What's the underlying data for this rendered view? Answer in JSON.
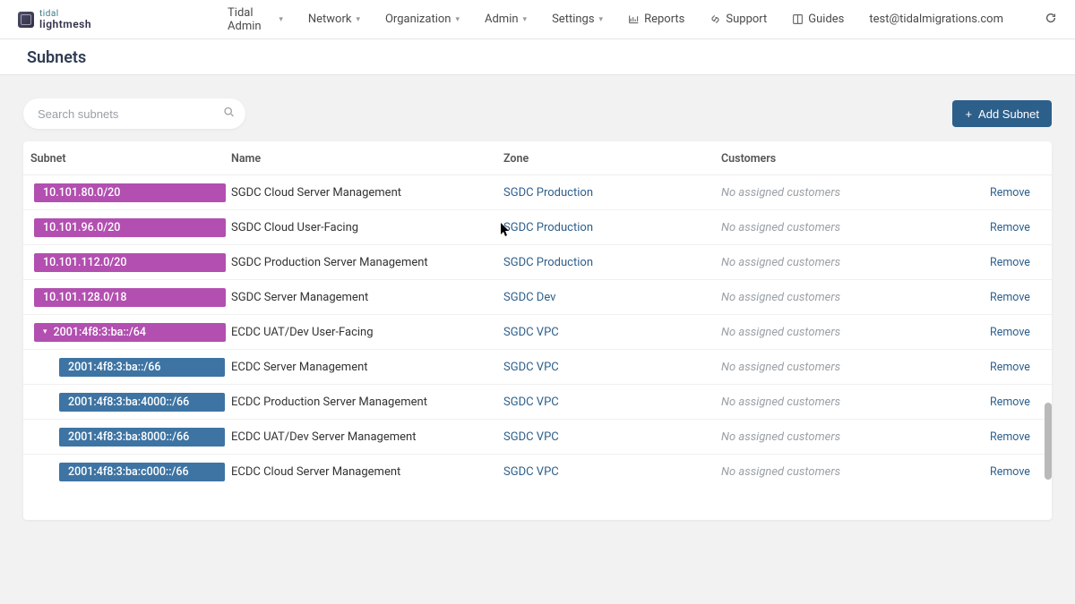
{
  "brand": {
    "line1": "tidal",
    "line2": "lightmesh"
  },
  "nav": {
    "tidal_admin": "Tidal Admin",
    "network": "Network",
    "organization": "Organization",
    "admin": "Admin",
    "settings": "Settings",
    "reports": "Reports",
    "support": "Support",
    "guides": "Guides",
    "user_email": "test@tidalmigrations.com"
  },
  "page_title": "Subnets",
  "search": {
    "placeholder": "Search subnets"
  },
  "add_subnet_label": "Add Subnet",
  "columns": {
    "subnet": "Subnet",
    "name": "Name",
    "zone": "Zone",
    "customers": "Customers"
  },
  "no_customers": "No assigned customers",
  "remove_label": "Remove",
  "rows": [
    {
      "cidr": "10.101.80.0/20",
      "name": "SGDC Cloud Server Management",
      "zone": "SGDC Production",
      "color": "purple",
      "child": false,
      "caret": false
    },
    {
      "cidr": "10.101.96.0/20",
      "name": "SGDC Cloud User-Facing",
      "zone": "SGDC Production",
      "color": "purple",
      "child": false,
      "caret": false
    },
    {
      "cidr": "10.101.112.0/20",
      "name": "SGDC Production Server Management",
      "zone": "SGDC Production",
      "color": "purple",
      "child": false,
      "caret": false
    },
    {
      "cidr": "10.101.128.0/18",
      "name": "SGDC Server Management",
      "zone": "SGDC Dev",
      "color": "purple",
      "child": false,
      "caret": false
    },
    {
      "cidr": "2001:4f8:3:ba::/64",
      "name": "ECDC UAT/Dev User-Facing",
      "zone": "SGDC VPC",
      "color": "purple",
      "child": false,
      "caret": true
    },
    {
      "cidr": "2001:4f8:3:ba::/66",
      "name": "ECDC Server Management",
      "zone": "SGDC VPC",
      "color": "blue",
      "child": true,
      "caret": false
    },
    {
      "cidr": "2001:4f8:3:ba:4000::/66",
      "name": "ECDC Production Server Management",
      "zone": "SGDC VPC",
      "color": "blue",
      "child": true,
      "caret": false
    },
    {
      "cidr": "2001:4f8:3:ba:8000::/66",
      "name": "ECDC UAT/Dev Server Management",
      "zone": "SGDC VPC",
      "color": "blue",
      "child": true,
      "caret": false
    },
    {
      "cidr": "2001:4f8:3:ba:c000::/66",
      "name": "ECDC Cloud Server Management",
      "zone": "SGDC VPC",
      "color": "blue",
      "child": true,
      "caret": false
    }
  ]
}
